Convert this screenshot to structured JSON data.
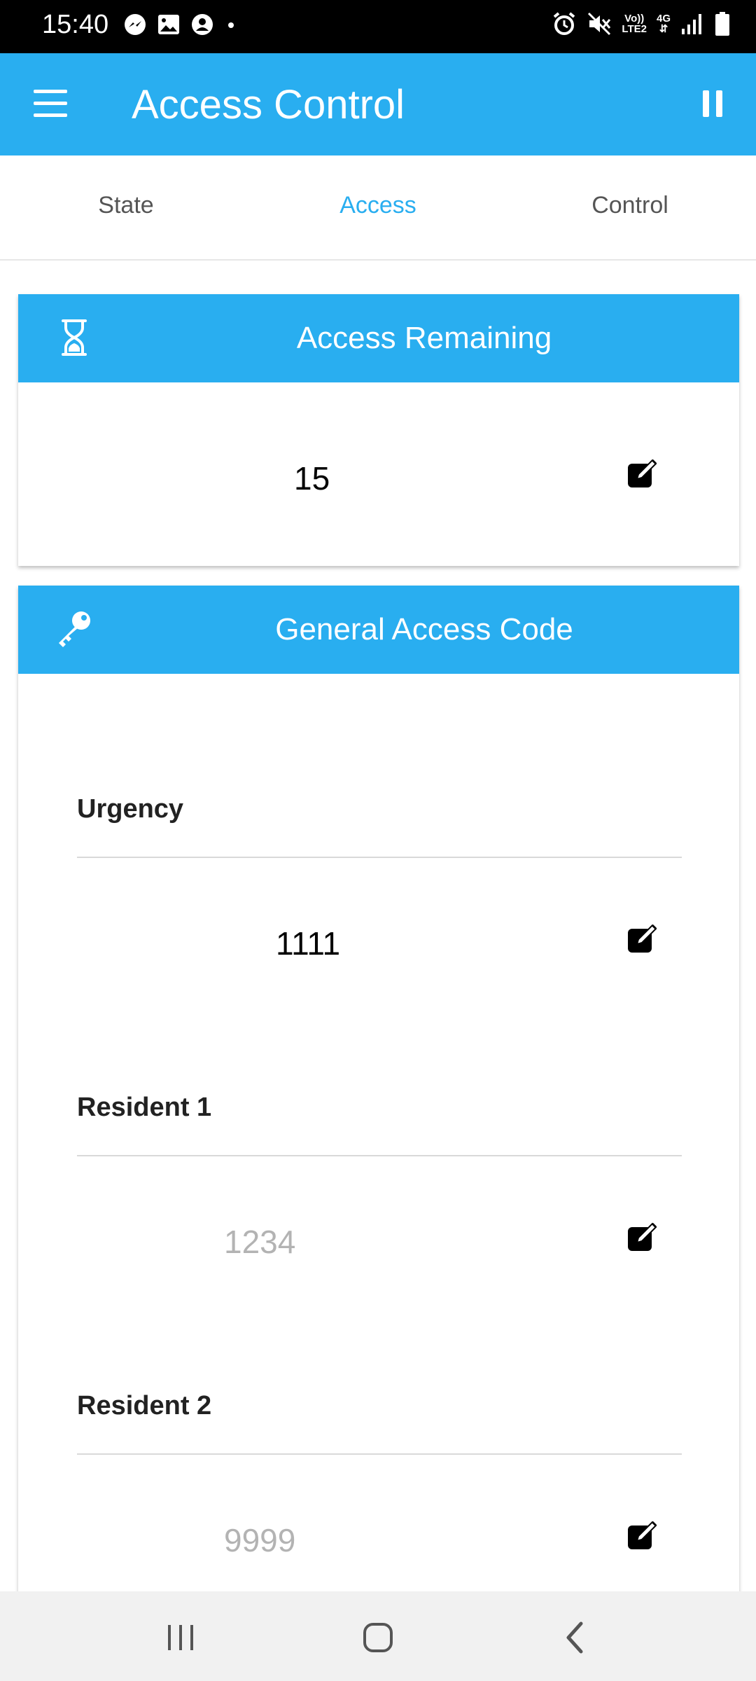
{
  "status_bar": {
    "time": "15:40",
    "left_icons": [
      "messenger-icon",
      "image-icon",
      "account-circle-icon",
      "dot-icon"
    ],
    "right_icons": [
      "alarm-icon",
      "mute-icon",
      "volte-icon",
      "network-4g-icon",
      "signal-icon",
      "battery-icon"
    ],
    "volte_label": "Vo))",
    "volte_sub": "LTE2",
    "network_label": "4G"
  },
  "app_bar": {
    "title": "Access Control",
    "menu_icon": "menu-icon",
    "pause_icon": "pause-icon"
  },
  "tabs": [
    {
      "label": "State",
      "active": false
    },
    {
      "label": "Access",
      "active": true
    },
    {
      "label": "Control",
      "active": false
    }
  ],
  "access_remaining": {
    "title": "Access Remaining",
    "icon": "hourglass-icon",
    "value": "15",
    "edit_icon": "edit-icon"
  },
  "general_access_code": {
    "title": "General Access Code",
    "icon": "key-icon",
    "fields": [
      {
        "label": "Urgency",
        "value": "1111",
        "is_placeholder": false
      },
      {
        "label": "Resident 1",
        "value": "1234",
        "is_placeholder": true
      },
      {
        "label": "Resident 2",
        "value": "9999",
        "is_placeholder": true
      }
    ]
  },
  "nav_bar": {
    "icons": [
      "recent-apps-icon",
      "home-icon",
      "back-icon"
    ]
  },
  "colors": {
    "accent": "#29aef0",
    "status_bar": "#000000",
    "placeholder_text": "#b3b3b3"
  }
}
